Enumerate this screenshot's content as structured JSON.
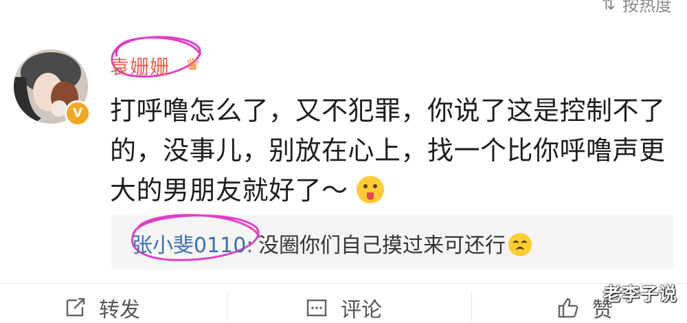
{
  "header": {
    "sort_label": "按热度",
    "sort_icon": "sort-icon"
  },
  "comment": {
    "username": "袁姗姗",
    "badge_icon": "crown-icon",
    "verified_icon": "v-badge",
    "text": "打呼噜怎么了，又不犯罪，你说了这是控制不了的，没事儿，别放在心上，找一个比你呼噜声更大的男朋友就好了～",
    "emoji": "tongue-wink-emoji"
  },
  "reply": {
    "username": "张小斐0110",
    "separator": ":",
    "text": "没圈你们自己摸过来可还行",
    "emoji": "upside-down-emoji"
  },
  "actions": {
    "repost_label": "转发",
    "comment_label": "评论",
    "like_label": "赞"
  },
  "watermark": "老李子说",
  "colors": {
    "username": "#e8604c",
    "reply_username": "#3a6fb0",
    "highlight_circle": "#e040c8",
    "verified": "#f5a623"
  }
}
